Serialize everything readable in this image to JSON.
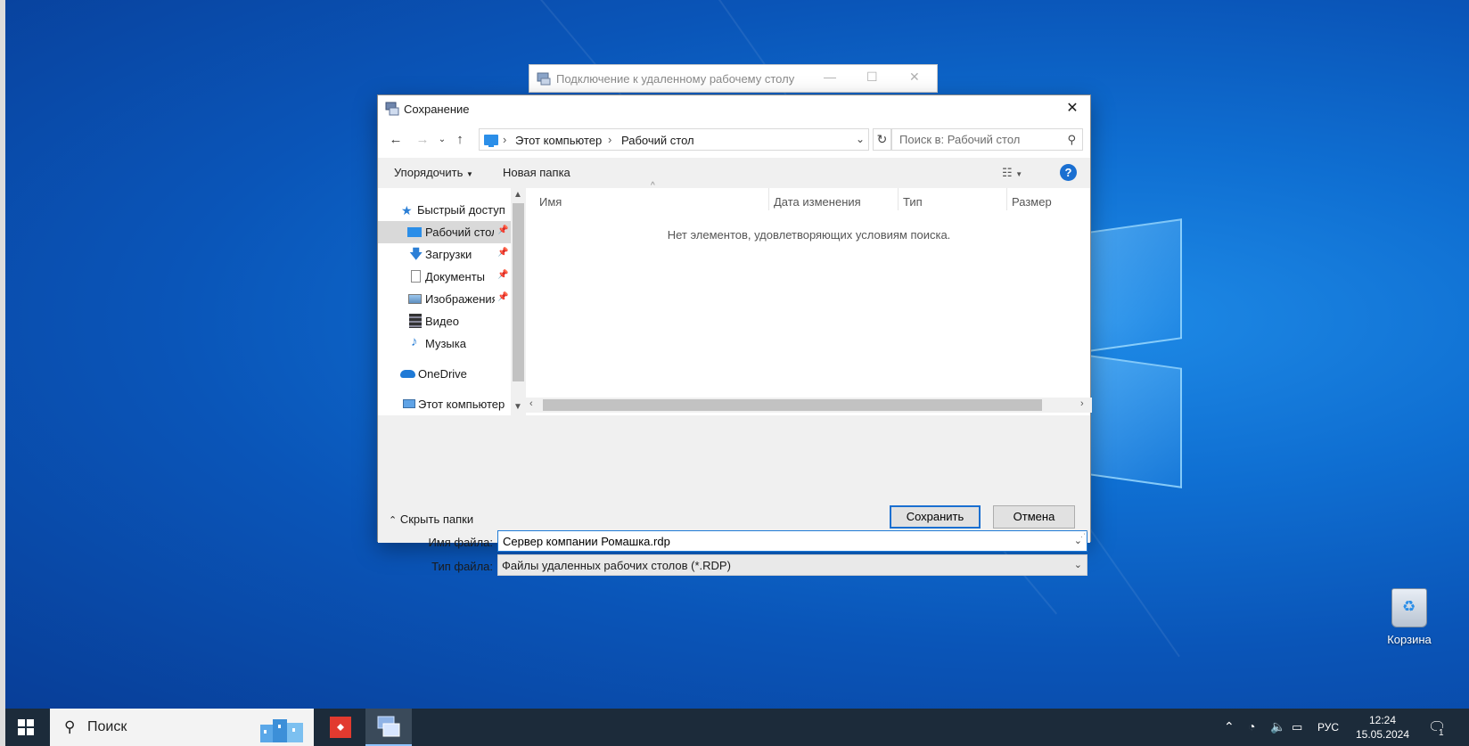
{
  "background_window": {
    "title": "Подключение к удаленному рабочему столу"
  },
  "dialog": {
    "title": "Сохранение",
    "address": {
      "crumbs": [
        "Этот компьютер",
        "Рабочий стол"
      ]
    },
    "search": {
      "placeholder": "Поиск в: Рабочий стол"
    },
    "toolbar": {
      "organize": "Упорядочить",
      "new_folder": "Новая папка"
    },
    "sidebar": {
      "items": [
        {
          "label": "Быстрый доступ",
          "icon": "star-icon"
        },
        {
          "label": "Рабочий стол",
          "icon": "desktop-icon",
          "pinned": true,
          "selected": true
        },
        {
          "label": "Загрузки",
          "icon": "download-icon",
          "pinned": true
        },
        {
          "label": "Документы",
          "icon": "documents-icon",
          "pinned": true
        },
        {
          "label": "Изображения",
          "icon": "pictures-icon",
          "pinned": true
        },
        {
          "label": "Видео",
          "icon": "video-icon"
        },
        {
          "label": "Музыка",
          "icon": "music-icon"
        },
        {
          "label": "OneDrive",
          "icon": "cloud-icon"
        },
        {
          "label": "Этот компьютер",
          "icon": "computer-icon"
        }
      ]
    },
    "columns": [
      "Имя",
      "Дата изменения",
      "Тип",
      "Размер"
    ],
    "empty_message": "Нет элементов, удовлетворяющих условиям поиска.",
    "filename_label": "Имя файла:",
    "filename_value": "Сервер компании Ромашка.rdp",
    "filetype_label": "Тип файла:",
    "filetype_value": "Файлы удаленных рабочих столов (*.RDP)",
    "hide_folders": "Скрыть папки",
    "save_button": "Сохранить",
    "cancel_button": "Отмена"
  },
  "desktop": {
    "recycle_bin": "Корзина"
  },
  "taskbar": {
    "search_label": "Поиск",
    "language": "РУС",
    "time": "12:24",
    "date": "15.05.2024",
    "notifications_count": "1"
  },
  "colors": {
    "accent": "#1a6fd1",
    "taskbar": "#1c2b3a"
  }
}
